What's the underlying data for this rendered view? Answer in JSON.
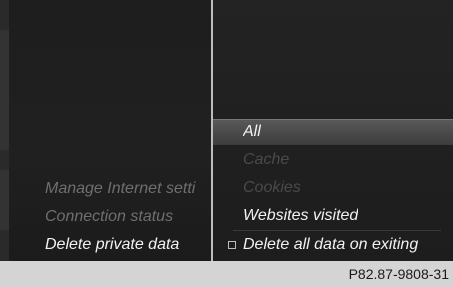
{
  "left_menu": {
    "items": [
      {
        "label": "Manage Internet setti"
      },
      {
        "label": "Connection status"
      },
      {
        "label": "Delete private data"
      }
    ]
  },
  "right_menu": {
    "items": [
      {
        "label": "All"
      },
      {
        "label": "Cache"
      },
      {
        "label": "Cookies"
      },
      {
        "label": "Websites visited"
      },
      {
        "label": "Delete all data on exiting"
      }
    ]
  },
  "figure_code": "P82.87-9808-31"
}
